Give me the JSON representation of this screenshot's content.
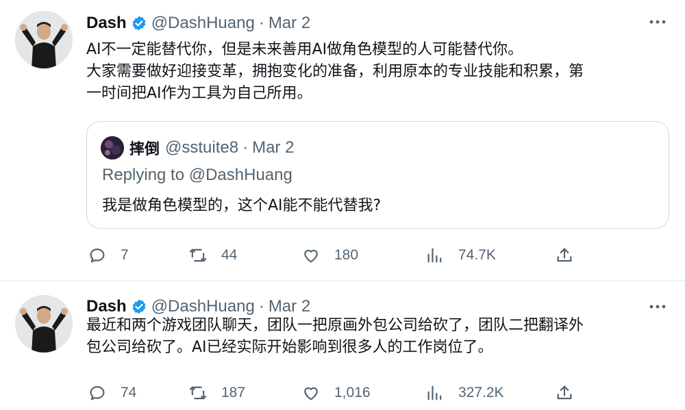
{
  "tweets": [
    {
      "author": {
        "name": "Dash",
        "handle": "@DashHuang",
        "date": "Mar 2",
        "verified": true
      },
      "lines": [
        "AI不一定能替代你，但是未来善用AI做角色模型的人可能替代你。",
        "大家需要做好迎接变革，拥抱变化的准备，利用原本的专业技能和积累，第",
        "一时间把AI作为工具为自己所用。"
      ],
      "quote": {
        "name": "摔倒",
        "handle": "@sstuite8",
        "date": "Mar 2",
        "replying_to": "Replying to @DashHuang",
        "text": "我是做角色模型的，这个AI能不能代替我?"
      },
      "actions": {
        "replies": "7",
        "retweets": "44",
        "likes": "180",
        "views": "74.7K"
      }
    },
    {
      "author": {
        "name": "Dash",
        "handle": "@DashHuang",
        "date": "Mar 2",
        "verified": true
      },
      "lines": [
        "最近和两个游戏团队聊天，团队一把原画外包公司给砍了，团队二把翻译外",
        "包公司给砍了。AI已经实际开始影响到很多人的工作岗位了。"
      ],
      "actions": {
        "replies": "74",
        "retweets": "187",
        "likes": "1,016",
        "views": "327.2K"
      }
    }
  ],
  "colors": {
    "text": "#0f1419",
    "secondary": "#536471",
    "verified": "#1d9bf0",
    "border": "#cfd9de"
  },
  "icons": [
    "verified-badge-icon",
    "more-icon",
    "reply-icon",
    "retweet-icon",
    "like-icon",
    "views-icon",
    "share-icon"
  ]
}
